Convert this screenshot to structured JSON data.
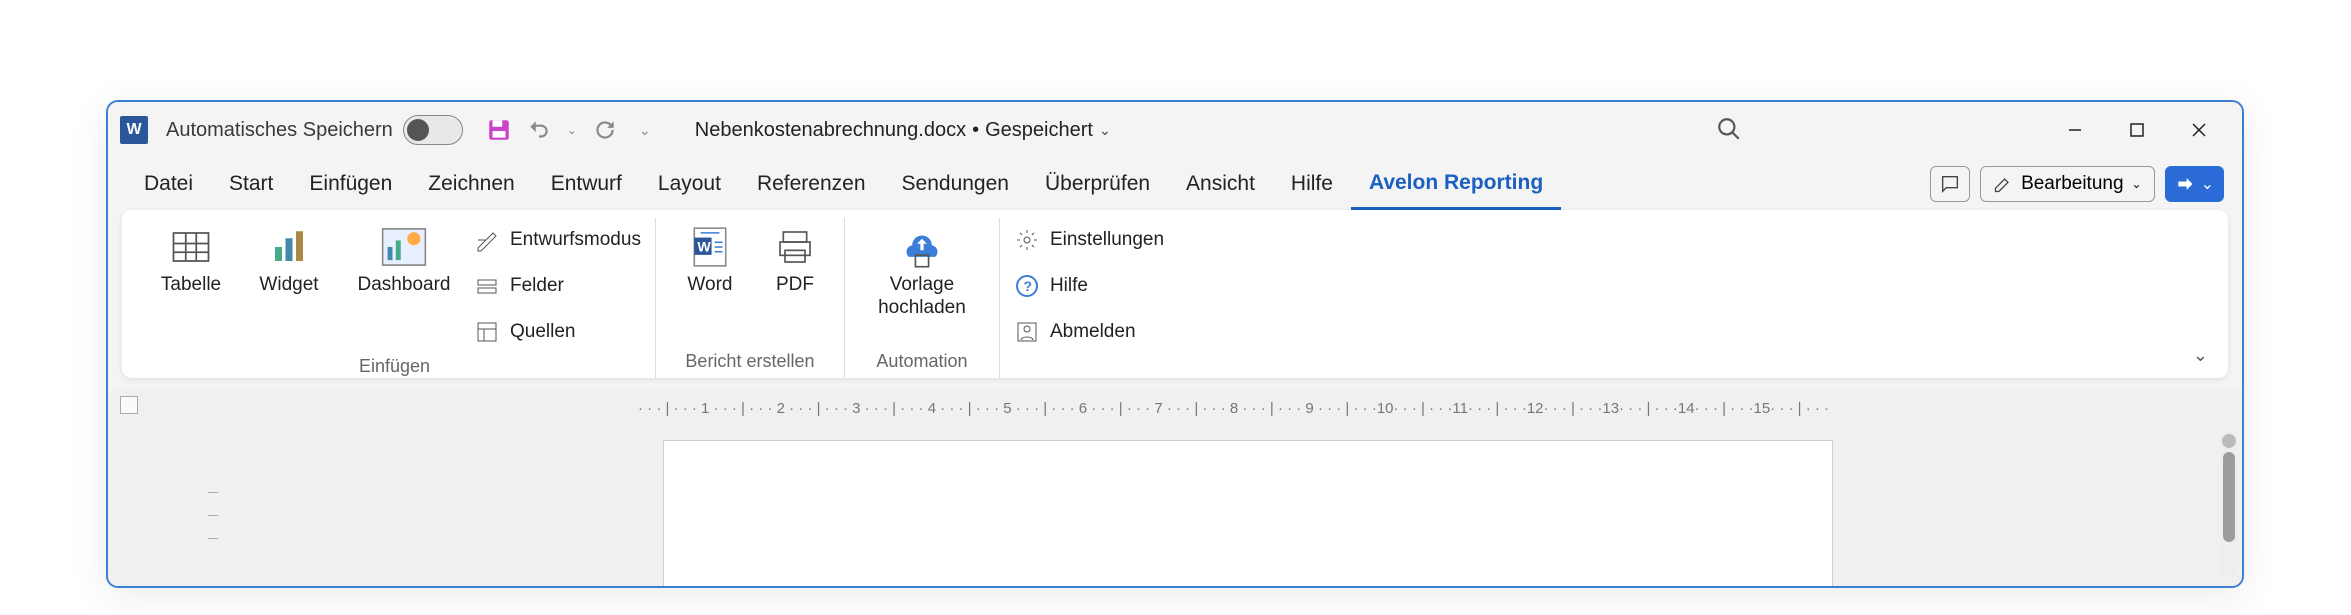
{
  "titlebar": {
    "autosave_label": "Automatisches Speichern",
    "doc_name": "Nebenkostenabrechnung.docx",
    "doc_state": "Gespeichert"
  },
  "tabs": [
    "Datei",
    "Start",
    "Einfügen",
    "Zeichnen",
    "Entwurf",
    "Layout",
    "Referenzen",
    "Sendungen",
    "Überprüfen",
    "Ansicht",
    "Hilfe",
    "Avelon Reporting"
  ],
  "active_tab": "Avelon Reporting",
  "edit_mode_label": "Bearbeitung",
  "ribbon": {
    "groups": [
      {
        "name": "Einfügen",
        "big_buttons": [
          "Tabelle",
          "Widget",
          "Dashboard"
        ],
        "small_buttons": [
          "Entwurfsmodus",
          "Felder",
          "Quellen"
        ]
      },
      {
        "name": "Bericht erstellen",
        "big_buttons": [
          "Word",
          "PDF"
        ]
      },
      {
        "name": "Automation",
        "big_buttons": [
          "Vorlage hochladen"
        ]
      },
      {
        "name": "",
        "small_buttons": [
          "Einstellungen",
          "Hilfe",
          "Abmelden"
        ]
      }
    ]
  },
  "ruler_text": "· · · | · · · 1 · · · | · · · 2 · · · | · · · 3 · · · | · · · 4 · · · | · · · 5 · · · | · · · 6 · · · | · · · 7 · · · | · · · 8 · · · | · · · 9 · · · | · · ·10· · · | · · ·11· · · | · · ·12· · · | · · ·13· · · | · · ·14· · · | · · ·15· · · | · · ·"
}
